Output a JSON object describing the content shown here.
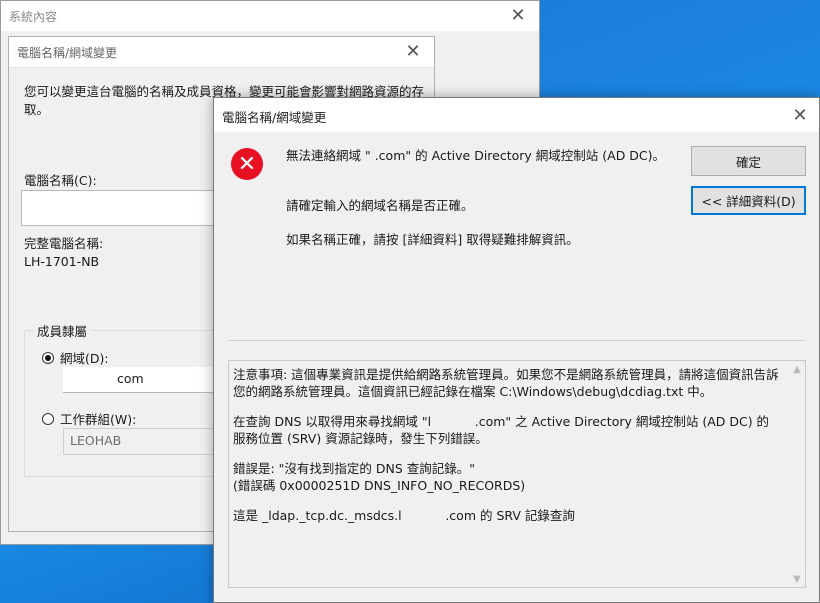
{
  "system_properties": {
    "title": "系統內容"
  },
  "rename_dialog": {
    "title": "電腦名稱/網域變更",
    "description": "您可以變更這台電腦的名稱及成員資格，變更可能會影響對網路資源的存取。",
    "computer_name_label": "電腦名稱(C):",
    "computer_name_value": "",
    "full_name_label": "完整電腦名稱:",
    "full_name_value": "LH-1701-NB",
    "member_of_label": "成員隸屬",
    "domain_label": "網域(D):",
    "domain_value": "com",
    "workgroup_label": "工作群組(W):",
    "workgroup_value": "LEOHAB"
  },
  "error_dialog": {
    "title": "電腦名稱/網域變更",
    "message_1": "無法連絡網域 \"           .com\" 的 Active Directory 網域控制站 (AD DC)。",
    "message_2": "請確定輸入的網域名稱是否正確。",
    "message_3": "如果名稱正確，請按 [詳細資料] 取得疑難排解資訊。",
    "ok_label": "確定",
    "details_button_label": "<< 詳細資料(D)",
    "details": {
      "p1": "注意事項: 這個專業資訊是提供給網路系統管理員。如果您不是網路系統管理員，請將這個資訊告訴您的網路系統管理員。這個資訊已經記錄在檔案 C:\\Windows\\debug\\dcdiag.txt 中。",
      "p2": "在查詢 DNS 以取得用來尋找網域 \"l           .com\" 之 Active Directory 網域控制站 (AD DC) 的服務位置 (SRV) 資源記錄時，發生下列錯誤。",
      "p3": "錯誤是: \"沒有找到指定的 DNS 查詢記錄。\"\n(錯誤碼 0x0000251D DNS_INFO_NO_RECORDS)",
      "p4": "這是 _ldap._tcp.dc._msdcs.l           .com 的 SRV 記錄查詢"
    }
  },
  "icons": {
    "close": "close-icon",
    "error": "error-icon"
  },
  "colors": {
    "error_red": "#e81123",
    "focus_blue": "#0078d7",
    "desktop_blue": "#1a8fe8"
  }
}
